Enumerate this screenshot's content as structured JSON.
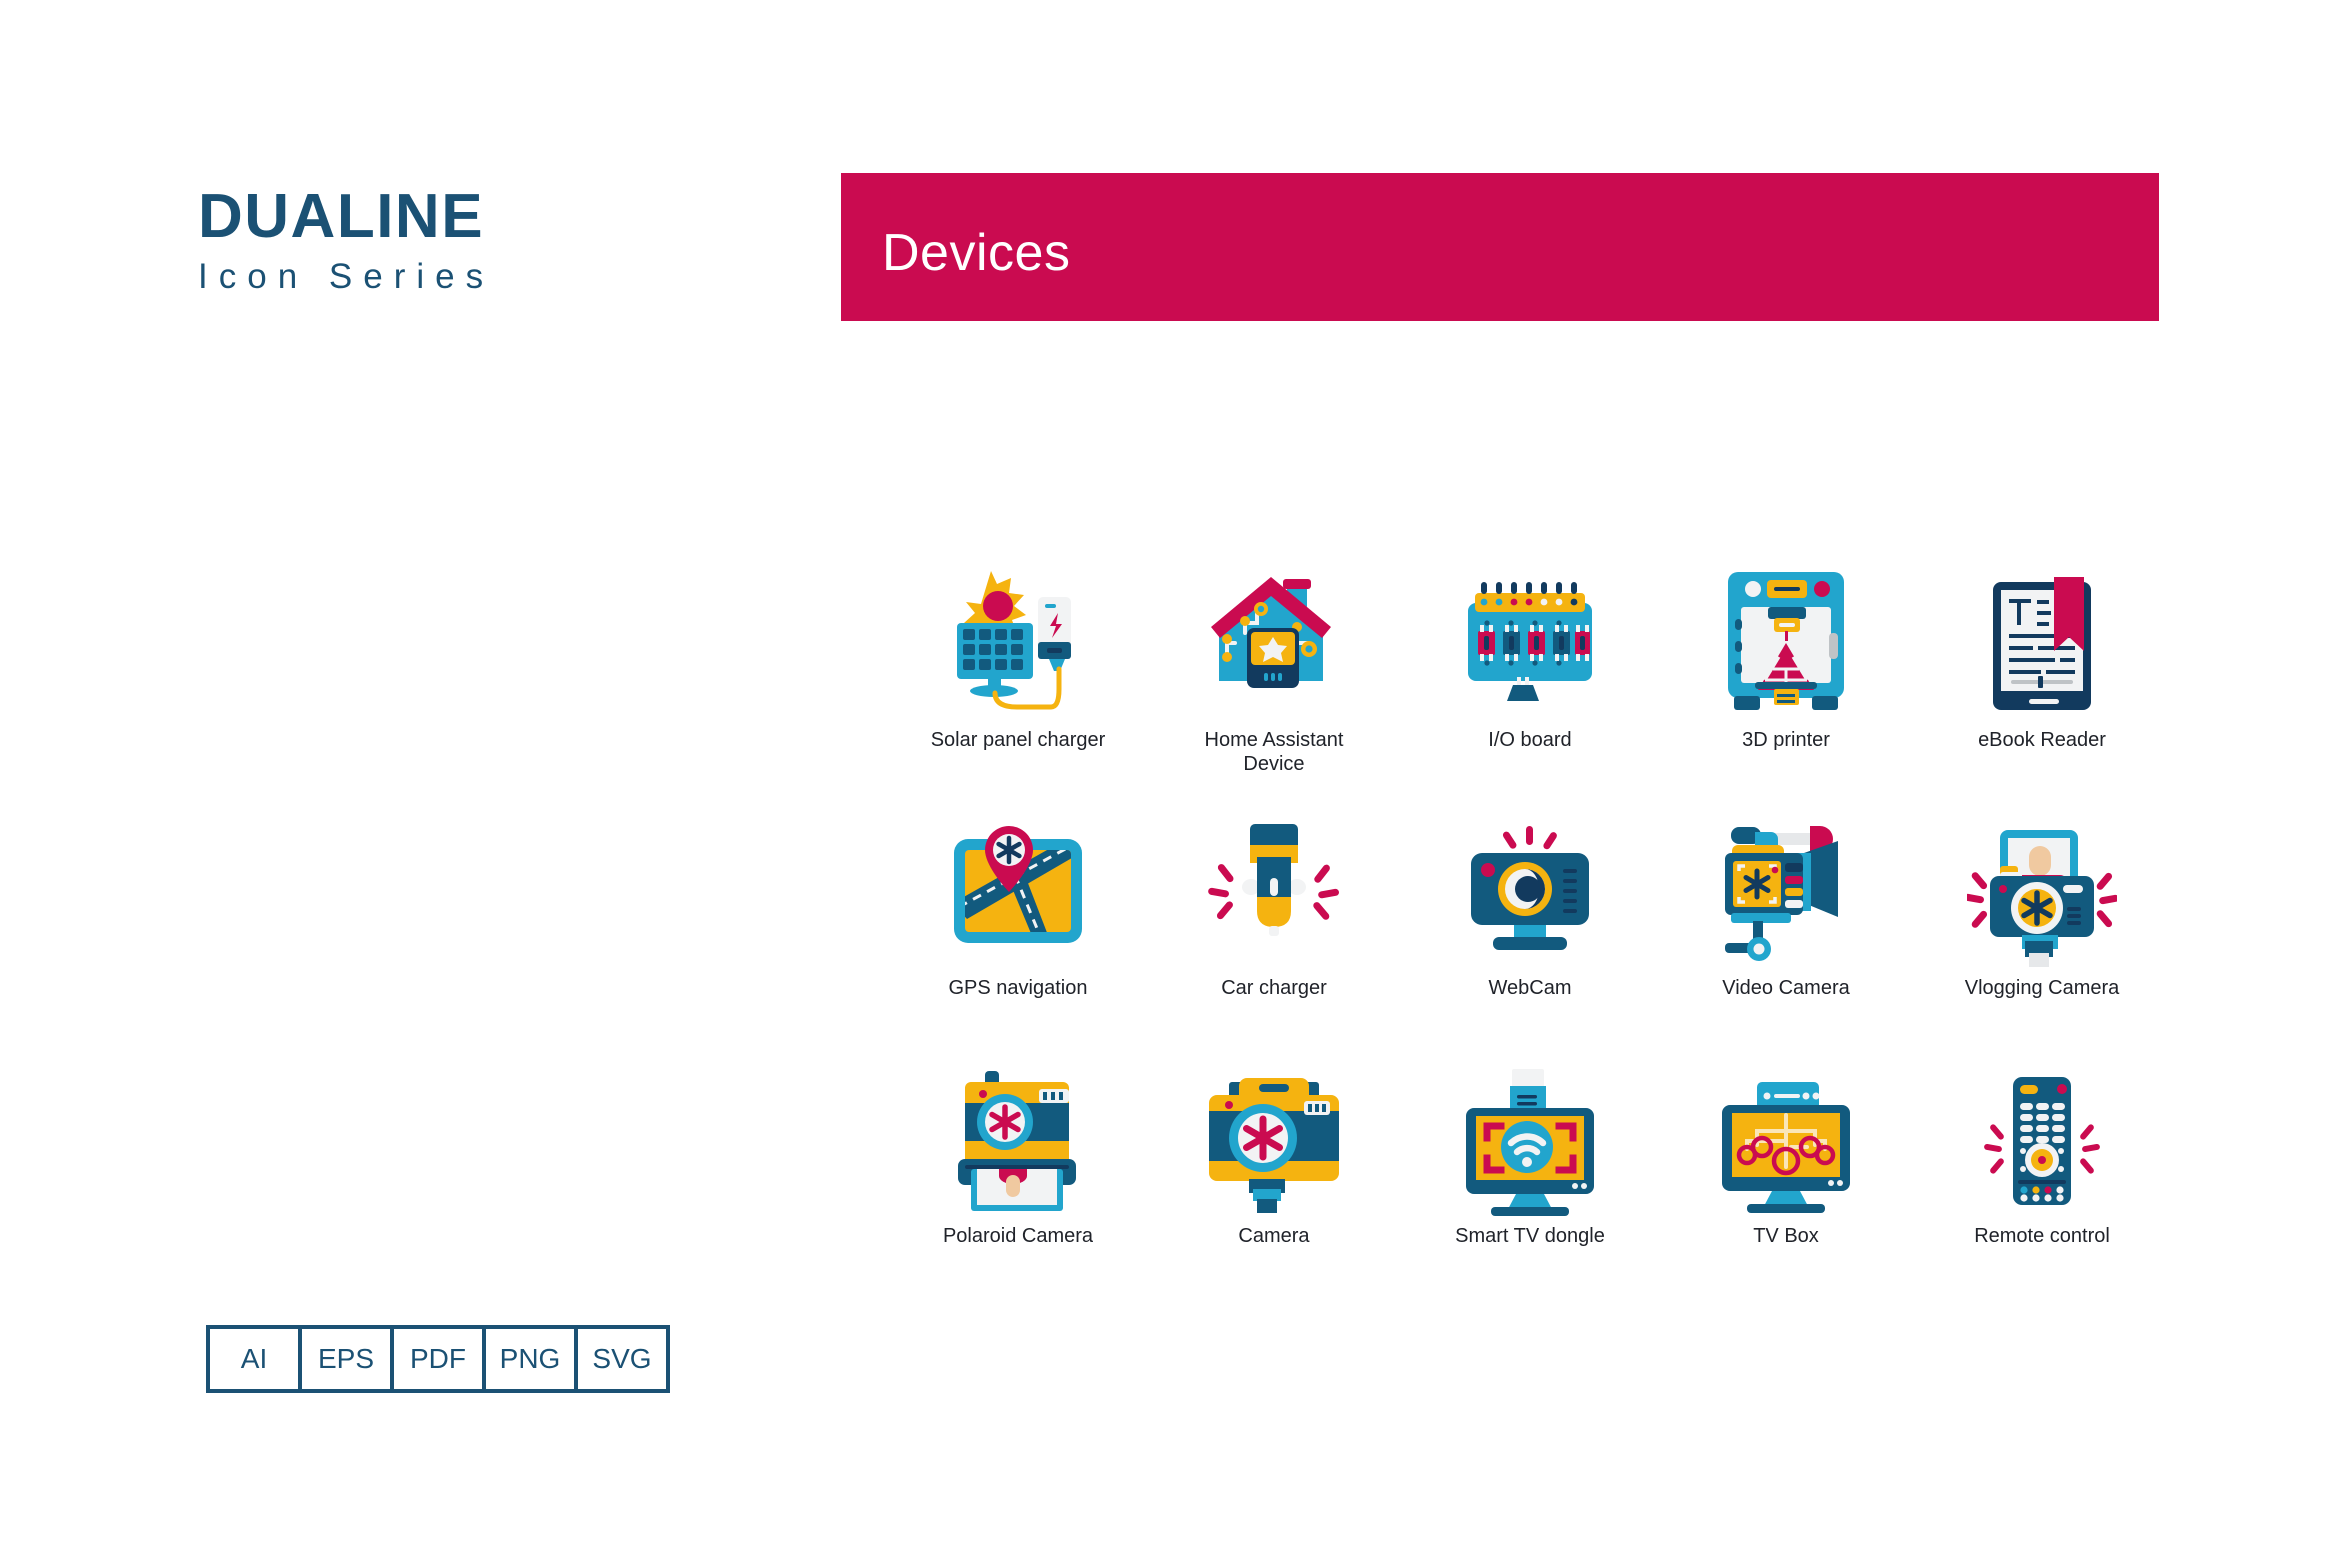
{
  "brand": {
    "title": "DUALINE",
    "subtitle": "Icon Series"
  },
  "header": {
    "title": "Devices",
    "banner_color": "#ca0b50"
  },
  "palette": {
    "navy": "#123a5e",
    "deep_blue": "#125a7e",
    "cyan": "#22a5cd",
    "crimson": "#ca0b50",
    "yellow": "#f5b310",
    "gold": "#f9c116",
    "white": "#f2f3f4",
    "skin": "#f0c9a0",
    "text": "#20232a"
  },
  "formats": [
    {
      "label": "AI"
    },
    {
      "label": "EPS"
    },
    {
      "label": "PDF"
    },
    {
      "label": "PNG"
    },
    {
      "label": "SVG"
    }
  ],
  "icons": [
    {
      "id": "solar-panel-charger",
      "label": "Solar panel charger"
    },
    {
      "id": "home-assistant-device",
      "label": "Home Assistant Device"
    },
    {
      "id": "io-board",
      "label": "I/O board"
    },
    {
      "id": "3d-printer",
      "label": "3D printer"
    },
    {
      "id": "ebook-reader",
      "label": "eBook Reader"
    },
    {
      "id": "gps-navigation",
      "label": "GPS navigation"
    },
    {
      "id": "car-charger",
      "label": "Car charger"
    },
    {
      "id": "webcam",
      "label": "WebCam"
    },
    {
      "id": "video-camera",
      "label": "Video Camera"
    },
    {
      "id": "vlogging-camera",
      "label": "Vlogging Camera"
    },
    {
      "id": "polaroid-camera",
      "label": "Polaroid Camera"
    },
    {
      "id": "camera",
      "label": "Camera"
    },
    {
      "id": "smart-tv-dongle",
      "label": "Smart TV dongle"
    },
    {
      "id": "tv-box",
      "label": "TV Box"
    },
    {
      "id": "remote-control",
      "label": "Remote control"
    }
  ]
}
